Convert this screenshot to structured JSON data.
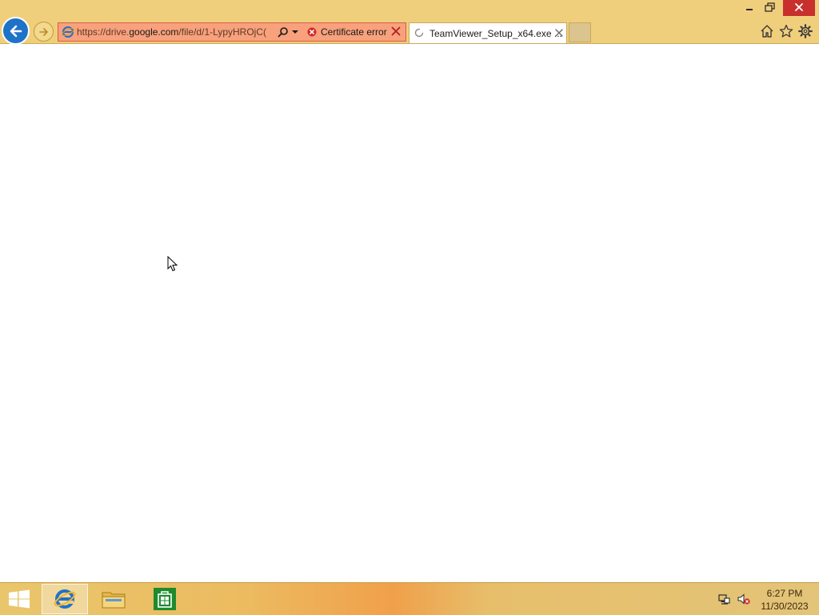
{
  "window": {
    "minimize_icon": "minimize-icon",
    "restore_icon": "restore-icon",
    "close_icon": "close-icon",
    "close_color": "#c7302c",
    "chrome_color": "#f0cf7c"
  },
  "navigation": {
    "back_icon": "back-arrow-icon",
    "forward_icon": "forward-arrow-icon"
  },
  "addressbar": {
    "url_prefix": "https://drive.",
    "url_host": "google.com",
    "url_path": "/file/d/1-LypyHROjC(",
    "certificate_text": "Certificate error",
    "error_color": "#f8a17c"
  },
  "tabs": [
    {
      "title": "TeamViewer_Setup_x64.exe ...",
      "loading": true
    }
  ],
  "toolbar": {
    "home_icon": "home-icon",
    "favorites_icon": "star-icon",
    "tools_icon": "gear-icon"
  },
  "taskbar": {
    "apps": [
      {
        "name": "Internet Explorer",
        "icon": "ie-icon",
        "active": true
      },
      {
        "name": "File Explorer",
        "icon": "folder-icon",
        "active": false
      },
      {
        "name": "Store",
        "icon": "store-icon",
        "active": false
      }
    ],
    "clock": {
      "time": "6:27 PM",
      "date": "11/30/2023"
    }
  }
}
